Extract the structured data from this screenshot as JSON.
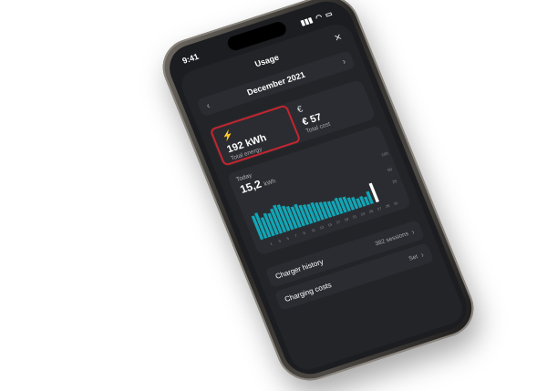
{
  "status": {
    "time": "9:41",
    "signal": "▮▮▮",
    "wifi": "◠",
    "battery": "▭"
  },
  "header": {
    "title": "Usage",
    "close_icon": "×"
  },
  "month": {
    "label": "December 2021",
    "prev": "‹",
    "next": "›"
  },
  "cards": [
    {
      "icon": "⚡",
      "value": "192 kWh",
      "label": "Total energy"
    },
    {
      "icon": "€",
      "value": "€ 57",
      "label": "Total cost"
    }
  ],
  "chart": {
    "today_label": "Today",
    "value": "15,2",
    "unit": "kWh",
    "accent": "#12a5b5"
  },
  "chart_data": {
    "type": "bar",
    "ylabels": [
      "100",
      "50",
      "25"
    ],
    "xlabels": [
      "1",
      "3",
      "5",
      "7",
      "9",
      "11",
      "13",
      "15",
      "17",
      "19",
      "21",
      "23",
      "25",
      "27",
      "29",
      "31"
    ],
    "values": [
      58,
      62,
      48,
      55,
      52,
      60,
      66,
      64,
      58,
      54,
      50,
      53,
      48,
      46,
      44,
      45,
      42,
      40,
      38,
      36,
      34,
      38,
      36,
      35,
      30,
      28,
      22,
      24,
      20,
      30
    ],
    "highlight_color": "#ffffff"
  },
  "rows": [
    {
      "label": "Charger history",
      "right": "382 sessions",
      "chevron": "›"
    },
    {
      "label": "Charging costs",
      "right": "Set",
      "chevron": "›"
    }
  ]
}
